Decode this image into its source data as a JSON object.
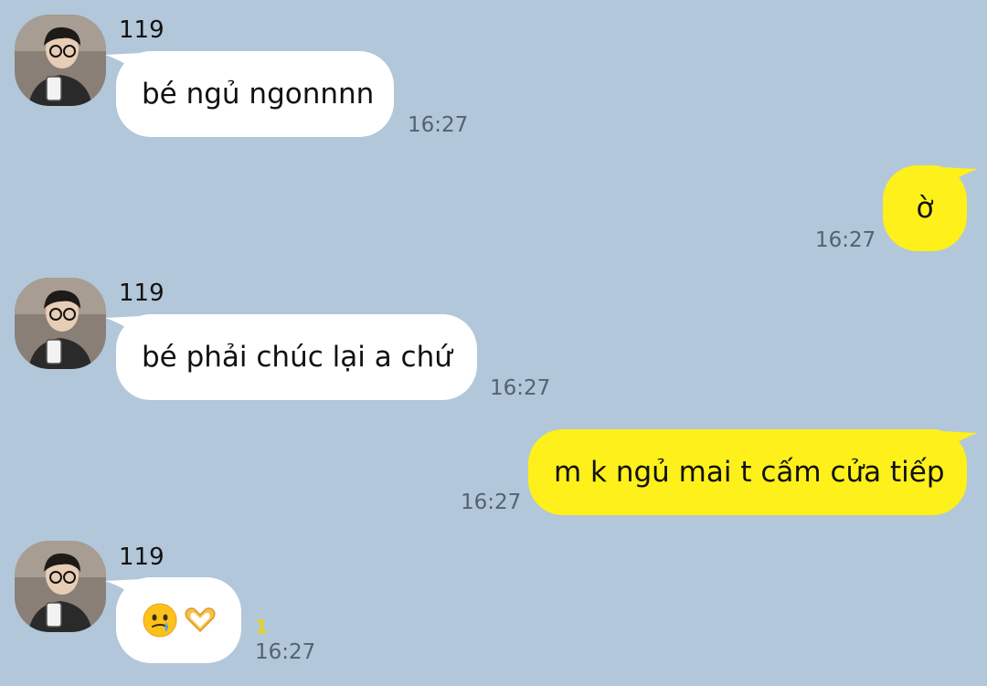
{
  "colors": {
    "background": "#b2c7d9",
    "incoming_bubble": "#ffffff",
    "outgoing_bubble": "#fef01b",
    "timestamp": "#556270",
    "unread_count": "#e7d21a"
  },
  "messages": [
    {
      "direction": "incoming",
      "sender": "119",
      "text": "bé ngủ ngonnnn",
      "time": "16:27"
    },
    {
      "direction": "outgoing",
      "text": "ờ",
      "time": "16:27"
    },
    {
      "direction": "incoming",
      "sender": "119",
      "text": "bé phải chúc lại a chứ",
      "time": "16:27"
    },
    {
      "direction": "outgoing",
      "text": "m k ngủ mai t cấm cửa tiếp",
      "time": "16:27"
    },
    {
      "direction": "incoming",
      "sender": "119",
      "emoji_icons": [
        "face-holding-back-tears-icon",
        "heart-hands-icon"
      ],
      "time": "16:27",
      "unread": "1"
    }
  ]
}
